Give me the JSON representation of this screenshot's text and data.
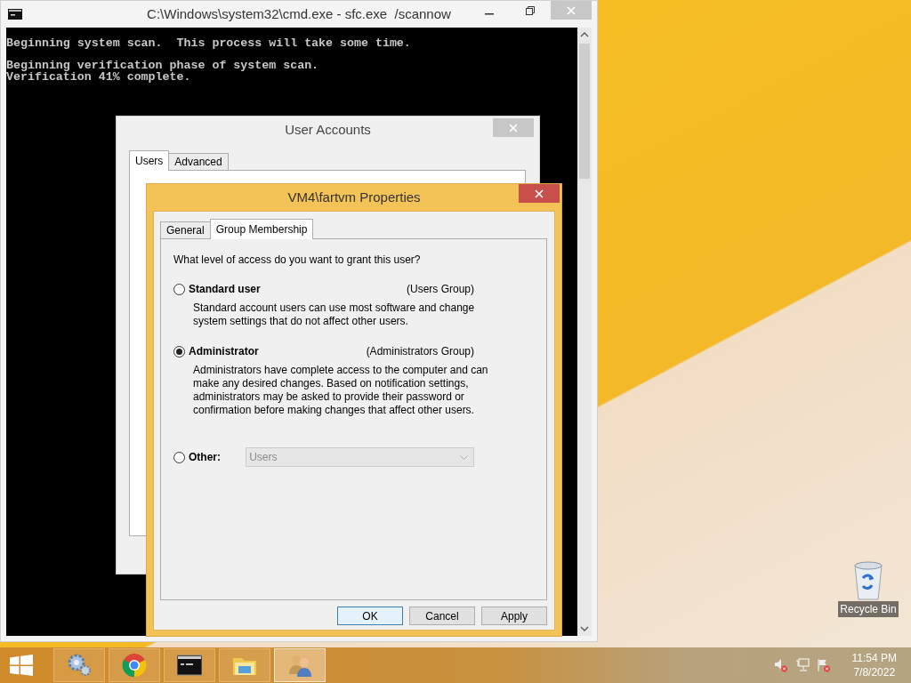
{
  "cmd_window": {
    "title": "C:\\Windows\\system32\\cmd.exe - sfc.exe  /scannow",
    "paragraphs": [
      [
        "Beginning system scan.  This process will take some time."
      ],
      [
        "Beginning verification phase of system scan.",
        "Verification 41% complete."
      ]
    ]
  },
  "user_accounts": {
    "title": "User Accounts",
    "tabs": [
      {
        "label": "Users",
        "selected": true
      },
      {
        "label": "Advanced",
        "selected": false
      }
    ]
  },
  "properties": {
    "title": "VM4\\fartvm Properties",
    "tabs": [
      {
        "label": "General",
        "selected": false
      },
      {
        "label": "Group Membership",
        "selected": true
      }
    ],
    "question": "What level of access do you want to grant this user?",
    "options": [
      {
        "kind": "described",
        "label": "Standard user",
        "group": "(Users Group)",
        "description": "Standard account users can use most software and change system settings that do not affect other users.",
        "selected": false
      },
      {
        "kind": "described",
        "label": "Administrator",
        "group": "(Administrators Group)",
        "description": "Administrators have complete access to the computer and can make any desired changes. Based on notification settings, administrators may be asked to provide their password or confirmation before making changes that affect other users.",
        "selected": true
      },
      {
        "kind": "dropdown",
        "label": "Other:",
        "dropdown": {
          "value": "Users",
          "disabled": true
        },
        "selected": false
      }
    ],
    "buttons": [
      {
        "label": "OK",
        "default": true
      },
      {
        "label": "Cancel",
        "default": false
      },
      {
        "label": "Apply",
        "default": false
      }
    ]
  },
  "desktop_icons": [
    {
      "label": "Recycle Bin"
    }
  ],
  "taskbar": {
    "apps": [
      {
        "kind": "settings",
        "active": false
      },
      {
        "kind": "browser",
        "active": false
      },
      {
        "kind": "console",
        "active": false
      },
      {
        "kind": "folder",
        "active": false
      },
      {
        "kind": "users",
        "active": true
      }
    ],
    "tray": {
      "time": "11:54 PM",
      "date": "7/8/2022"
    }
  }
}
